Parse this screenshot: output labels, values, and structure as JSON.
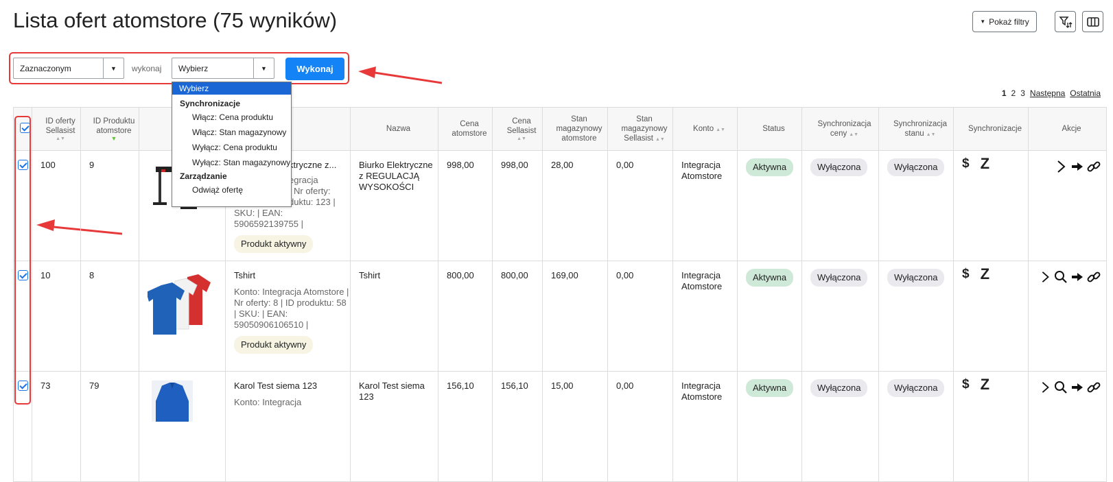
{
  "page": {
    "title": "Lista ofert atomstore (75 wyników)",
    "show_filters_label": "Pokaż filtry",
    "filter_sort_icon": "filter-sort-icon",
    "columns_icon": "columns-icon"
  },
  "bulk": {
    "scope_value": "Zaznaczonym",
    "action_label": "wykonaj",
    "action_value": "Wybierz",
    "execute_label": "Wykonaj"
  },
  "dropdown": {
    "selected": "Wybierz",
    "group1": "Synchronizacje",
    "opt1": "Włącz: Cena produktu",
    "opt2": "Włącz: Stan magazynowy",
    "opt3": "Wyłącz: Cena produktu",
    "opt4": "Wyłącz: Stan magazynowy",
    "group2": "Zarządzanie",
    "opt5": "Odwiąż ofertę"
  },
  "pagination": {
    "p1": "1",
    "p2": "2",
    "p3": "3",
    "next": "Następna",
    "last": "Ostatnia"
  },
  "table": {
    "headers": {
      "id_offer": "ID oferty Sellasist",
      "id_product": "ID Produktu atomstore",
      "name": "Nazwa",
      "price_atom": "Cena atomstore",
      "price_sell": "Cena Sellasist",
      "stock_atom": "Stan magazynowy atomstore",
      "stock_sell": "Stan magazynowy Sellasist",
      "account": "Konto",
      "status": "Status",
      "sync_price": "Synchronizacja ceny",
      "sync_stock": "Synchronizacja stanu",
      "sync": "Synchronizacje",
      "actions": "Akcje"
    },
    "rows": [
      {
        "id_offer": "100",
        "id_product": "9",
        "title": "Biurko Elektryczne z...",
        "title_visible": "ktryczne z...",
        "meta_visible_1": "egracja",
        "meta_visible_2": "| Nr oferty:",
        "meta_visible_3": "duktu: 123 |",
        "meta_visible_4": "SKU: | EAN:",
        "meta_visible_5": "5906592139755 |",
        "badge": "Produkt aktywny",
        "name": "Biurko Elektryczne z REGULACJĄ WYSOKOŚCI",
        "price_atom": "998,00",
        "price_sell": "998,00",
        "stock_atom": "28,00",
        "stock_sell": "0,00",
        "account": "Integracja Atomstore",
        "status": "Aktywna",
        "sync_price": "Wyłączona",
        "sync_stock": "Wyłączona"
      },
      {
        "id_offer": "10",
        "id_product": "8",
        "title": "Tshirt",
        "meta": "Konto: Integracja Atomstore | Nr oferty: 8 | ID produktu: 58 | SKU: | EAN: 59050906106510 |",
        "badge": "Produkt aktywny",
        "name": "Tshirt",
        "price_atom": "800,00",
        "price_sell": "800,00",
        "stock_atom": "169,00",
        "stock_sell": "0,00",
        "account": "Integracja Atomstore",
        "status": "Aktywna",
        "sync_price": "Wyłączona",
        "sync_stock": "Wyłączona"
      },
      {
        "id_offer": "73",
        "id_product": "79",
        "title": "Karol Test siema 123",
        "meta": "Konto: Integracja",
        "name": "Karol Test siema 123",
        "price_atom": "156,10",
        "price_sell": "156,10",
        "stock_atom": "15,00",
        "stock_sell": "0,00",
        "account": "Integracja Atomstore",
        "status": "Aktywna",
        "sync_price": "Wyłączona",
        "sync_stock": "Wyłączona"
      }
    ],
    "sync_icons": {
      "price": "$",
      "stock": "Z"
    }
  },
  "colors": {
    "primary": "#1483f5",
    "annotation_red": "#e8393a",
    "badge_green": "#cfe9d8",
    "badge_grey": "#e9e9ee",
    "badge_yellow": "#f7f4e3",
    "dropdown_selected": "#1a66d4"
  }
}
